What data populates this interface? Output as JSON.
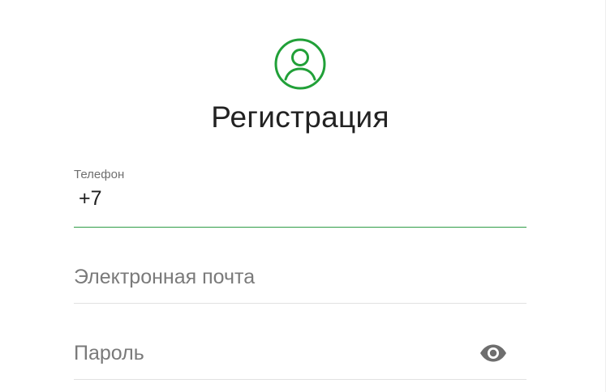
{
  "form": {
    "title": "Регистрация",
    "phone": {
      "label": "Телефон",
      "value": "+7"
    },
    "email": {
      "placeholder": "Электронная почта"
    },
    "password": {
      "placeholder": "Пароль"
    }
  },
  "icons": {
    "avatar": "user-circle-icon",
    "toggle_password": "eye-icon"
  },
  "colors": {
    "accent": "#21a038",
    "active_underline": "#2e9c47",
    "text": "#222222",
    "placeholder": "#7a7a7a",
    "icon_gray": "#6e6e6e"
  }
}
